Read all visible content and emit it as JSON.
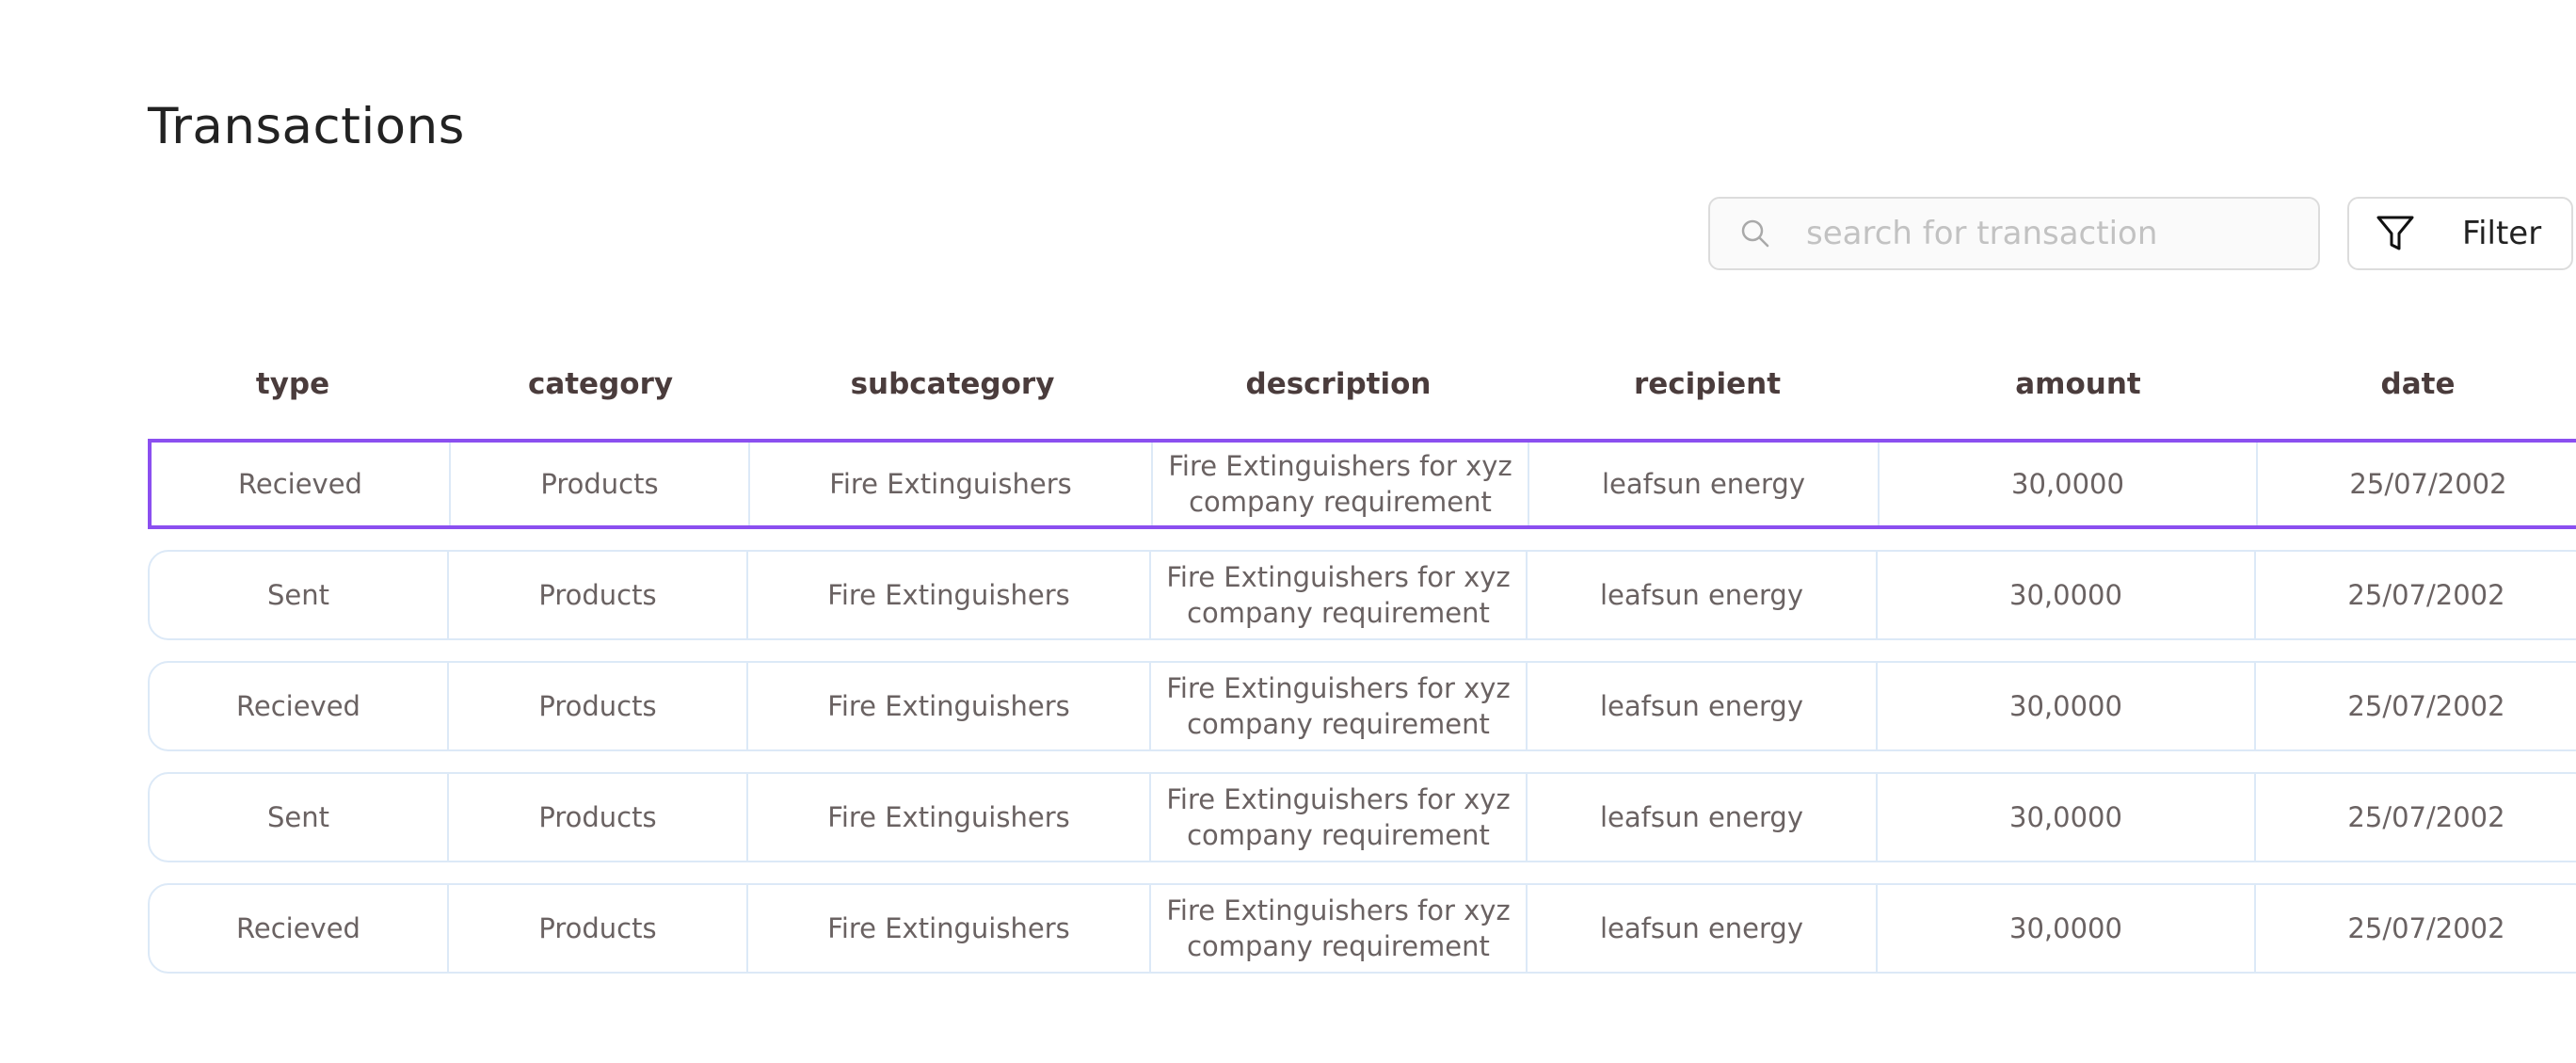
{
  "page": {
    "title": "Transactions"
  },
  "search": {
    "placeholder": "search for transaction",
    "value": "",
    "icon": "search-icon"
  },
  "filter": {
    "label": "Filter",
    "icon": "filter-icon"
  },
  "table": {
    "columns": [
      "type",
      "category",
      "subcategory",
      "description",
      "recipient",
      "amount",
      "date"
    ],
    "rows": [
      {
        "type": "Recieved",
        "category": "Products",
        "subcategory": "Fire Extinguishers",
        "description": "Fire Extinguishers for xyz company requirement",
        "recipient": "leafsun energy",
        "amount": "30,0000",
        "date": "25/07/2002",
        "selected": true
      },
      {
        "type": "Sent",
        "category": "Products",
        "subcategory": "Fire Extinguishers",
        "description": "Fire Extinguishers for xyz company requirement",
        "recipient": "leafsun energy",
        "amount": "30,0000",
        "date": "25/07/2002",
        "selected": false
      },
      {
        "type": "Recieved",
        "category": "Products",
        "subcategory": "Fire Extinguishers",
        "description": "Fire Extinguishers for xyz company requirement",
        "recipient": "leafsun energy",
        "amount": "30,0000",
        "date": "25/07/2002",
        "selected": false
      },
      {
        "type": "Sent",
        "category": "Products",
        "subcategory": "Fire Extinguishers",
        "description": "Fire Extinguishers for xyz company requirement",
        "recipient": "leafsun energy",
        "amount": "30,0000",
        "date": "25/07/2002",
        "selected": false
      },
      {
        "type": "Recieved",
        "category": "Products",
        "subcategory": "Fire Extinguishers",
        "description": "Fire Extinguishers for xyz company requirement",
        "recipient": "leafsun energy",
        "amount": "30,0000",
        "date": "25/07/2002",
        "selected": false
      }
    ]
  },
  "colors": {
    "selected_border": "#8b4ff0",
    "row_border": "#dce9f7",
    "header_text": "#4a3c3c",
    "cell_text": "#6a6262"
  }
}
